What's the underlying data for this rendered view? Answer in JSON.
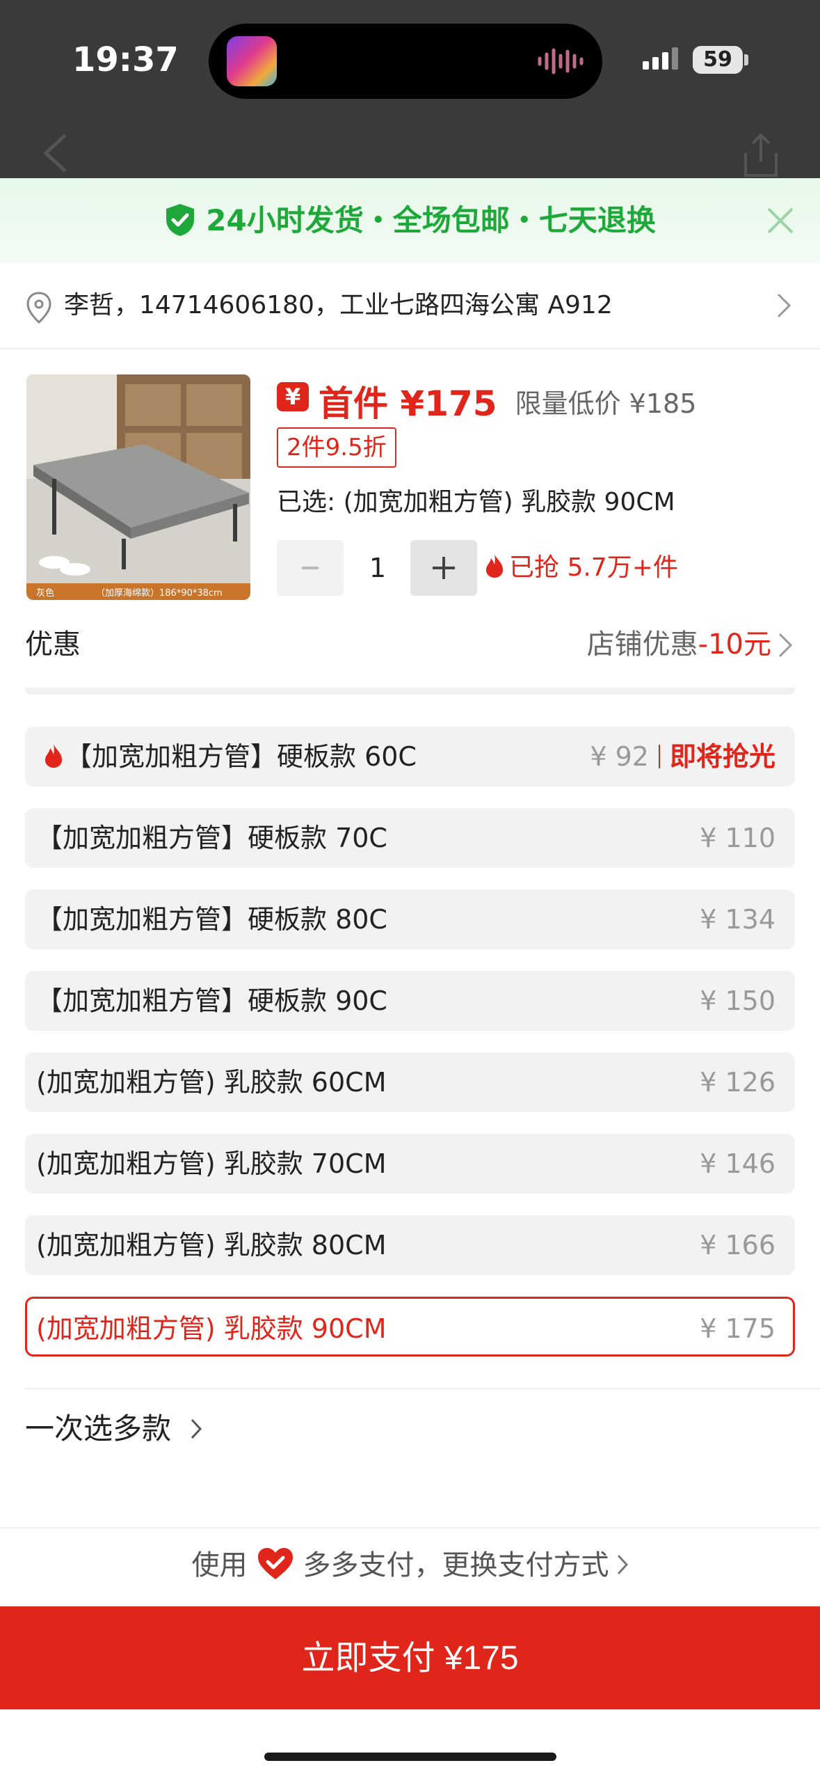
{
  "status_bar": {
    "time": "19:37",
    "battery": "59"
  },
  "banner": {
    "text": "24小时发货・全场包邮・七天退换"
  },
  "address": {
    "text": "李哲，14714606180，工业七路四海公寓 A912"
  },
  "product": {
    "price_prefix": "¥",
    "first_price": "首件 ¥175",
    "limited_price": "限量低价 ¥185",
    "discount": "2件9.5折",
    "selected": "已选: (加宽加粗方管) 乳胶款 90CM",
    "quantity": "1",
    "sold": "已抢 5.7万+件",
    "image": {
      "color_tag": "灰色",
      "spec_tag": "（加厚海绵款）186*90*38cm"
    }
  },
  "promo": {
    "label": "优惠",
    "value_prefix": "店铺优惠",
    "value_amount": "-10元"
  },
  "options": [
    {
      "label": "【加宽加粗方管】硬板款 60C",
      "price": "¥ 92",
      "hot": "即将抢光"
    },
    {
      "label": "【加宽加粗方管】硬板款 70C",
      "price": "¥ 110"
    },
    {
      "label": "【加宽加粗方管】硬板款 80C",
      "price": "¥ 134"
    },
    {
      "label": "【加宽加粗方管】硬板款 90C",
      "price": "¥ 150"
    },
    {
      "label": "(加宽加粗方管) 乳胶款 60CM",
      "price": "¥ 126"
    },
    {
      "label": "(加宽加粗方管) 乳胶款 70CM",
      "price": "¥ 146"
    },
    {
      "label": "(加宽加粗方管) 乳胶款 80CM",
      "price": "¥ 166"
    },
    {
      "label": "(加宽加粗方管) 乳胶款 90CM",
      "price": "¥ 175",
      "selected": true
    }
  ],
  "multi_select": {
    "label": "一次选多款"
  },
  "payment": {
    "prefix": "使用",
    "method": "多多支付，更换支付方式",
    "button": "立即支付 ¥175"
  },
  "colors": {
    "accent": "#e0251b",
    "green": "#1fa83a"
  }
}
